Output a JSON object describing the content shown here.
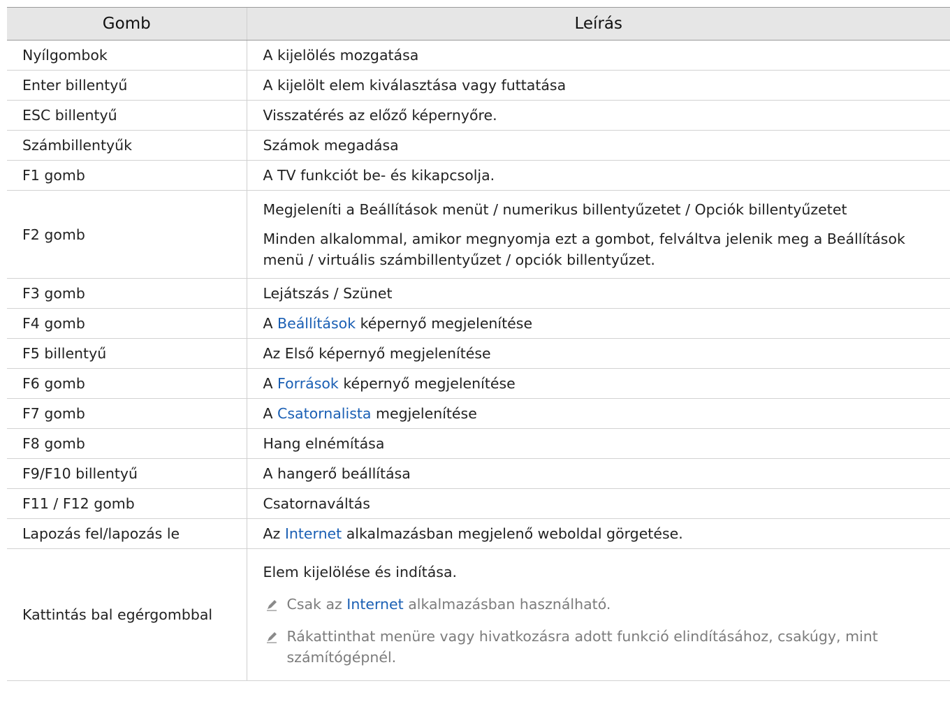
{
  "header": {
    "col1": "Gomb",
    "col2": "Leírás"
  },
  "rows": [
    {
      "key": "Nyílgombok",
      "desc": "A kijelölés mozgatása"
    },
    {
      "key": "Enter billentyű",
      "desc": "A kijelölt elem kiválasztása vagy futtatása"
    },
    {
      "key": "ESC billentyű",
      "desc": "Visszatérés az előző képernyőre."
    },
    {
      "key": "Számbillentyűk",
      "desc": "Számok megadása"
    },
    {
      "key": "F1 gomb",
      "desc": "A TV funkciót be- és kikapcsolja."
    },
    {
      "key": "F2 gomb",
      "desc1": "Megjeleníti a Beállítások menüt / numerikus billentyűzetet / Opciók billentyűzetet",
      "desc2": "Minden alkalommal, amikor megnyomja ezt a gombot, felváltva jelenik meg a Beállítások menü / virtuális számbillentyűzet / opciók billentyűzet."
    },
    {
      "key": "F3 gomb",
      "desc": "Lejátszás / Szünet"
    },
    {
      "key": "F4 gomb",
      "pre": "A ",
      "link": "Beállítások",
      "post": " képernyő megjelenítése"
    },
    {
      "key": "F5 billentyű",
      "desc": "Az Első képernyő megjelenítése"
    },
    {
      "key": "F6 gomb",
      "pre": "A ",
      "link": "Források",
      "post": " képernyő megjelenítése"
    },
    {
      "key": "F7 gomb",
      "pre": "A ",
      "link": "Csatornalista",
      "post": " megjelenítése"
    },
    {
      "key": "F8 gomb",
      "desc": "Hang elnémítása"
    },
    {
      "key": "F9/F10 billentyű",
      "desc": "A hangerő beállítása"
    },
    {
      "key": "F11 / F12 gomb",
      "desc": "Csatornaváltás"
    },
    {
      "key": "Lapozás fel/lapozás le",
      "pre": "Az ",
      "link": "Internet",
      "post": " alkalmazásban megjelenő weboldal görgetése."
    },
    {
      "key": "Kattintás bal egérgombbal",
      "desc": "Elem kijelölése és indítása.",
      "note1_pre": "Csak az ",
      "note1_link": "Internet",
      "note1_post": " alkalmazásban használható.",
      "note2": "Rákattinthat menüre vagy hivatkozásra adott funkció elindításához, csakúgy, mint számítógépnél."
    }
  ],
  "colors": {
    "link": "#1a5fb4",
    "note_text": "#7c7c7c",
    "header_bg": "#e6e6e6"
  },
  "icons": {
    "note": "pencil-note-icon"
  }
}
